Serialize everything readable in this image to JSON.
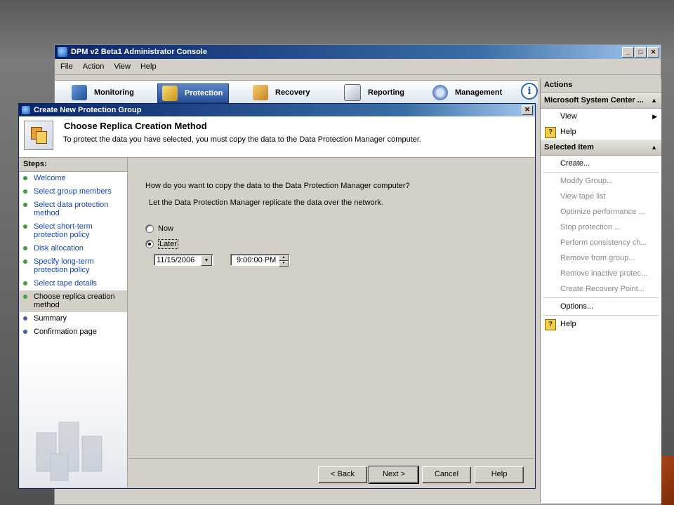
{
  "console": {
    "title": "DPM v2 Beta1 Administrator Console",
    "menu": [
      "File",
      "Action",
      "View",
      "Help"
    ],
    "tabs": [
      {
        "label": "Monitoring",
        "icon": "monitoring-icon"
      },
      {
        "label": "Protection",
        "icon": "protection-icon",
        "active": true
      },
      {
        "label": "Recovery",
        "icon": "recovery-icon"
      },
      {
        "label": "Reporting",
        "icon": "reporting-icon"
      },
      {
        "label": "Management",
        "icon": "management-icon"
      }
    ],
    "info_glyph": "i"
  },
  "actions": {
    "header": "Actions",
    "section1": {
      "title": "Microsoft System Center ...",
      "items": [
        {
          "label": "View",
          "submenu": true
        },
        {
          "label": "Help",
          "icon": "help-icon"
        }
      ]
    },
    "section2": {
      "title": "Selected Item",
      "items": [
        {
          "label": "Create...",
          "enabled": true
        },
        {
          "label": "Modify Group...",
          "enabled": false
        },
        {
          "label": "View tape list",
          "enabled": false
        },
        {
          "label": "Optimize performance ...",
          "enabled": false
        },
        {
          "label": "Stop protection ...",
          "enabled": false
        },
        {
          "label": "Perform consistency ch...",
          "enabled": false
        },
        {
          "label": "Remove from group...",
          "enabled": false
        },
        {
          "label": "Remove inactive protec...",
          "enabled": false
        },
        {
          "label": "Create Recovery Point...",
          "enabled": false
        },
        {
          "label": "Options...",
          "enabled": true
        },
        {
          "label": "Help",
          "enabled": true,
          "icon": "help-icon"
        }
      ]
    }
  },
  "dialog": {
    "title": "Create New Protection Group",
    "heading": "Choose Replica Creation Method",
    "subheading": "To protect the data you have selected, you must copy the data to the Data Protection Manager computer.",
    "steps_title": "Steps:",
    "steps": [
      {
        "label": "Welcome",
        "state": "done"
      },
      {
        "label": "Select group members",
        "state": "done"
      },
      {
        "label": "Select data protection method",
        "state": "done"
      },
      {
        "label": "Select short-term protection policy",
        "state": "done"
      },
      {
        "label": "Disk allocation",
        "state": "done"
      },
      {
        "label": "Specify long-term protection policy",
        "state": "done"
      },
      {
        "label": "Select tape details",
        "state": "done"
      },
      {
        "label": "Choose replica creation method",
        "state": "current"
      },
      {
        "label": "Summary",
        "state": "pending"
      },
      {
        "label": "Confirmation page",
        "state": "pending"
      }
    ],
    "question": "How do you want to copy the data to the Data Protection Manager computer?",
    "option_group_label": "Let the Data Protection Manager replicate the data over the network.",
    "radio_now": "Now",
    "radio_later": "Later",
    "selected": "Later",
    "date_value": "11/15/2006",
    "time_value": "9:00:00 PM",
    "buttons": {
      "back": "< Back",
      "next": "Next >",
      "cancel": "Cancel",
      "help": "Help"
    }
  }
}
